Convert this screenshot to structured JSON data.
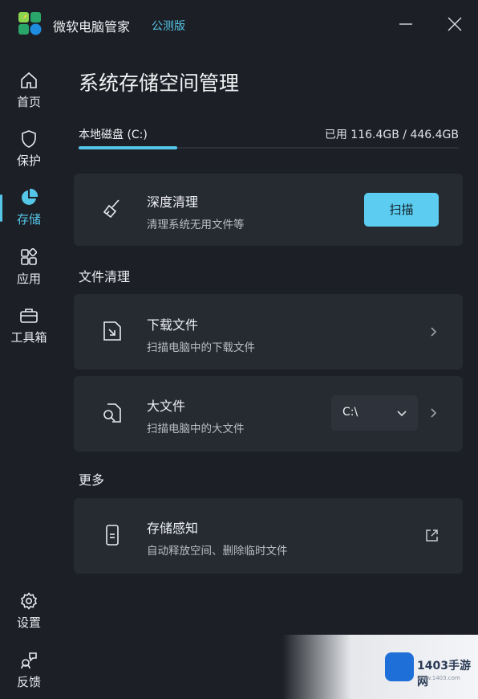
{
  "app": {
    "title": "微软电脑管家",
    "badge": "公测版"
  },
  "colors": {
    "accent": "#55c6e8",
    "background": "#1c1f25",
    "card": "#262a31",
    "button": "#5ccdf0"
  },
  "sidebar": {
    "items": [
      {
        "label": "首页",
        "icon": "home-icon"
      },
      {
        "label": "保护",
        "icon": "shield-icon"
      },
      {
        "label": "存储",
        "icon": "pie-chart-icon",
        "active": true
      },
      {
        "label": "应用",
        "icon": "apps-icon"
      },
      {
        "label": "工具箱",
        "icon": "toolbox-icon"
      }
    ],
    "bottom": [
      {
        "label": "设置",
        "icon": "gear-icon"
      },
      {
        "label": "反馈",
        "icon": "feedback-icon"
      }
    ]
  },
  "main": {
    "title": "系统存储空间管理",
    "disk": {
      "tab": "本地磁盘 (C:)",
      "usage": "已用 116.4GB / 446.4GB",
      "used_fraction": 0.26
    },
    "deep_clean": {
      "title": "深度清理",
      "subtitle": "清理系统无用文件等",
      "button": "扫描",
      "icon": "broom-icon"
    },
    "file_clean": {
      "heading": "文件清理",
      "items": [
        {
          "title": "下载文件",
          "subtitle": "扫描电脑中的下载文件",
          "icon": "download-file-icon"
        },
        {
          "title": "大文件",
          "subtitle": "扫描电脑中的大文件",
          "icon": "large-file-icon",
          "drive": "C:\\"
        }
      ]
    },
    "more": {
      "heading": "更多",
      "items": [
        {
          "title": "存储感知",
          "subtitle": "自动释放空间、删除临时文件",
          "icon": "phone-storage-icon"
        }
      ]
    }
  },
  "watermark": {
    "text": "1403手游网",
    "sub": "www.1403.com"
  }
}
